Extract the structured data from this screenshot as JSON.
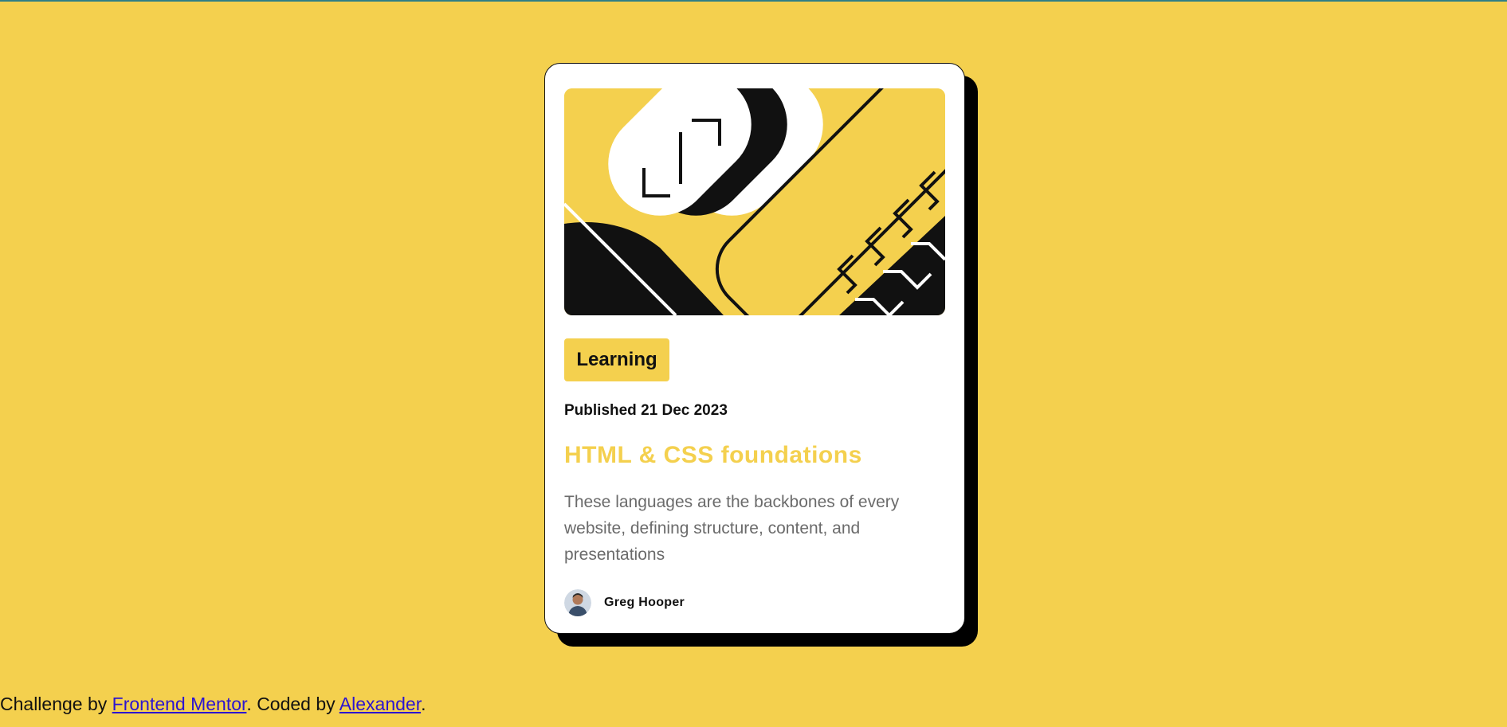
{
  "card": {
    "tag": "Learning",
    "published": "Published 21 Dec 2023",
    "title": "HTML & CSS foundations",
    "description": "These languages are the backbones of every website, defining structure, content, and presentations",
    "author": "Greg Hooper"
  },
  "footer": {
    "prefix": "Challenge by ",
    "link1": "Frontend Mentor",
    "middle": ". Coded by ",
    "link2": "Alexander",
    "suffix": "."
  },
  "colors": {
    "background": "#f4d04e",
    "card": "#ffffff",
    "shadow": "#000000",
    "muted_text": "#6b6b6b",
    "link": "#2c14d0"
  }
}
